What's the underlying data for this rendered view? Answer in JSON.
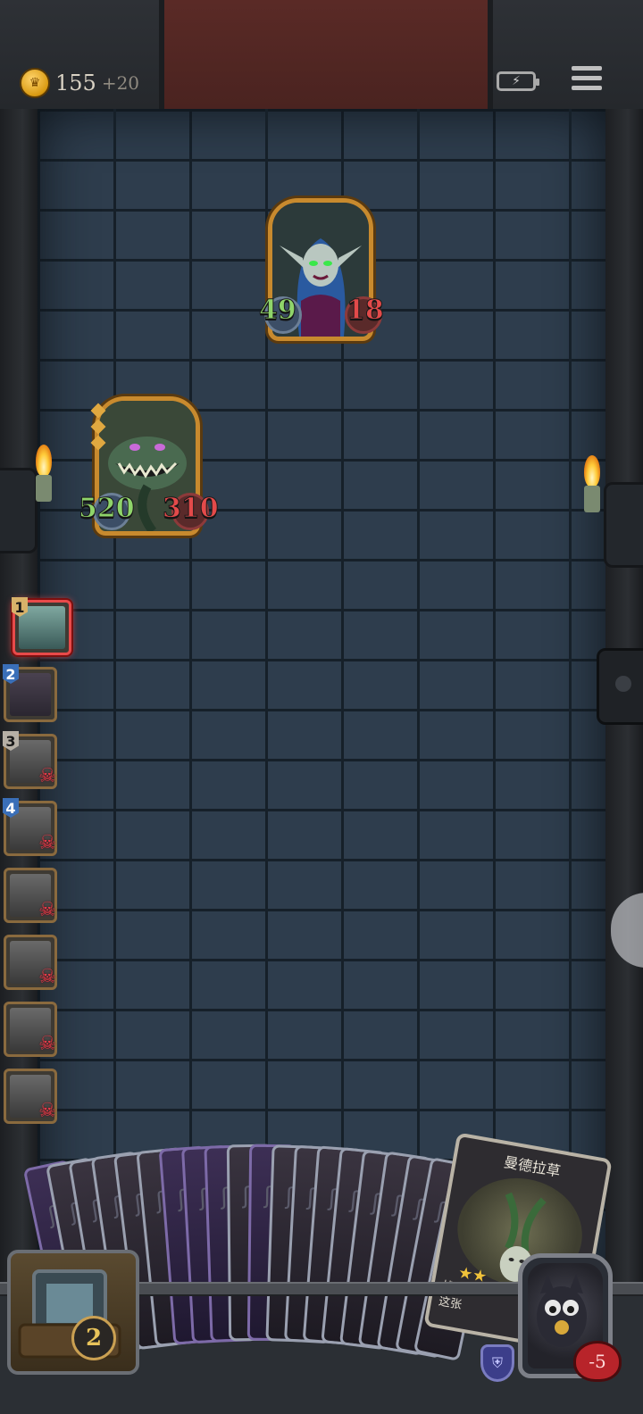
{
  "header": {
    "coins": "155",
    "coin_bonus": "+20"
  },
  "enemies": [
    {
      "name": "elf-witch",
      "hp": "49",
      "attack": "18"
    },
    {
      "name": "fanged-plant-monster",
      "hp": "520",
      "attack": "310"
    }
  ],
  "party": {
    "slots": [
      {
        "number": "1",
        "status": "alive",
        "selected": true
      },
      {
        "number": "2",
        "status": "alive",
        "selected": false
      },
      {
        "number": "3",
        "status": "dead",
        "selected": false
      },
      {
        "number": "4",
        "status": "dead",
        "selected": false
      },
      {
        "number": "",
        "status": "dead",
        "selected": false
      },
      {
        "number": "",
        "status": "dead",
        "selected": false
      },
      {
        "number": "",
        "status": "dead",
        "selected": false
      },
      {
        "number": "",
        "status": "dead",
        "selected": false
      }
    ]
  },
  "hand": {
    "card_back_count": 20,
    "front_card": {
      "title": "曼德拉草",
      "text_line1": "战斗结",
      "text_line2": "这张",
      "stars": "★★"
    }
  },
  "deck": {
    "count": "2"
  },
  "hero": {
    "hp": "-5"
  },
  "icons": {
    "coin": "crown-coin-icon",
    "battery": "battery-charging-icon",
    "menu": "hamburger-menu-icon",
    "skull": "skull-crossbones-icon",
    "shield": "shield-icon"
  },
  "colors": {
    "hp_text": "#8fd46a",
    "attack_text": "#e34a4a",
    "dead_marker": "#e83a4a",
    "frame_gold": "#c88a2e"
  }
}
